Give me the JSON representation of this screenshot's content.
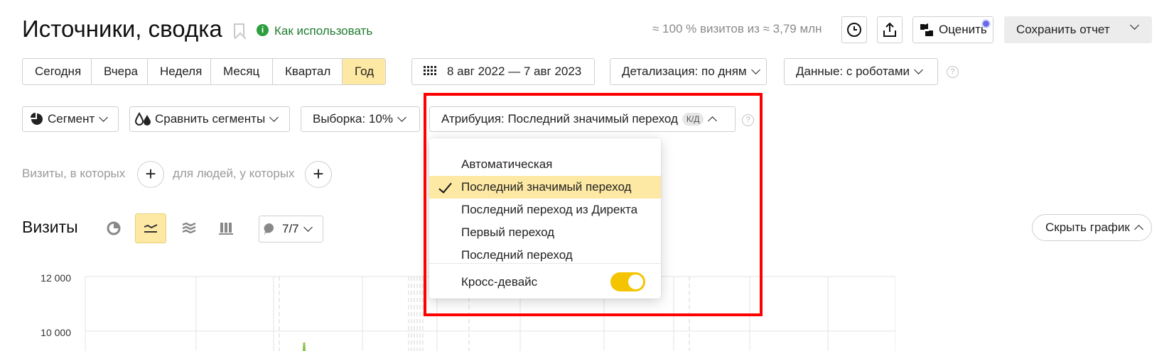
{
  "header": {
    "title": "Источники, сводка",
    "how_to_use": "Как использовать",
    "visits_info": "≈ 100 % визитов из ≈ 3,79 млн",
    "rate_label": "Оценить",
    "save_label": "Сохранить отчет"
  },
  "period": {
    "options": [
      "Сегодня",
      "Вчера",
      "Неделя",
      "Месяц",
      "Квартал",
      "Год"
    ],
    "active": "Год"
  },
  "date_range": "8 авг 2022 — 7 авг 2023",
  "detail_label": "Детализация: по дням",
  "data_label": "Данные: с роботами",
  "filters": {
    "segment_label": "Сегмент",
    "compare_label": "Сравнить сегменты",
    "sample_label": "Выборка: 10%",
    "attribution_label": "Атрибуция: Последний значимый переход",
    "attribution_badge": "К/Д"
  },
  "conditions": {
    "visits_where": "Визиты, в которых",
    "people_where": "для людей, у которых"
  },
  "attribution_menu": {
    "items": [
      "Автоматическая",
      "Последний значимый переход",
      "Последний переход из Директа",
      "Первый переход",
      "Последний переход"
    ],
    "selected": "Последний значимый переход",
    "cross_device_label": "Кросс-девайс",
    "cross_device_enabled": true
  },
  "chart_section": {
    "title": "Визиты",
    "series_counter": "7/7",
    "hide_chart_label": "Скрыть график"
  },
  "chart_data": {
    "type": "line",
    "y_ticks": [
      "12 000",
      "10 000"
    ],
    "ylim": [
      8000,
      12000
    ]
  },
  "colors": {
    "accent": "#fde9a3",
    "link_green": "#1d7a2d",
    "toggle": "#f5c400",
    "highlight_frame": "#ff0000",
    "series_green": "#8bc34a"
  }
}
